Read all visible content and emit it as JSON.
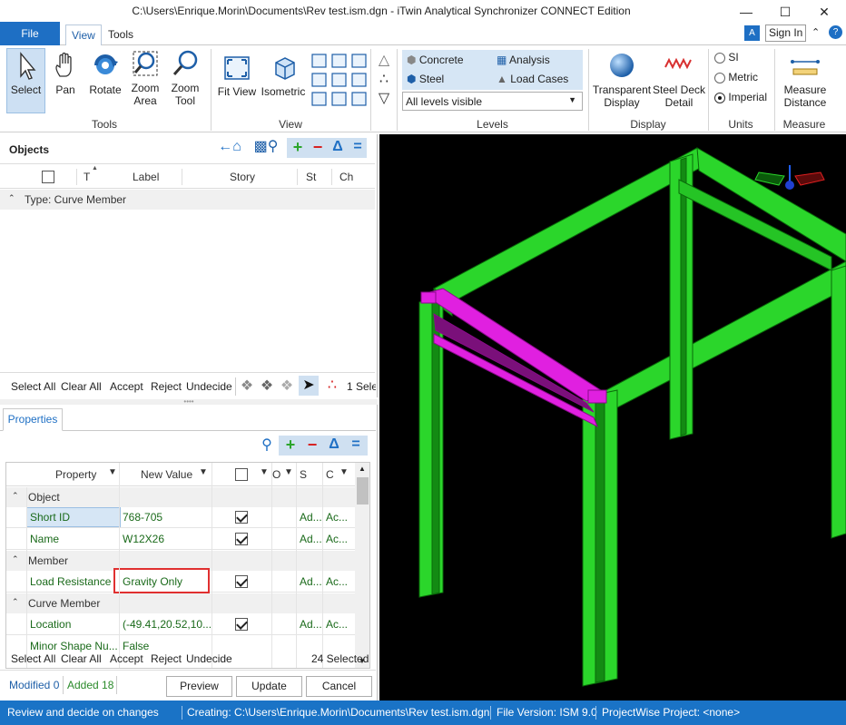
{
  "window": {
    "title": "C:\\Users\\Enrique.Morin\\Documents\\Rev test.ism.dgn - iTwin Analytical Synchronizer CONNECT Edition"
  },
  "menu": {
    "file": "File",
    "tabs": [
      "View",
      "Tools"
    ]
  },
  "account": {
    "sign_in": "Sign In"
  },
  "ribbon": {
    "tools": {
      "select": "Select",
      "pan": "Pan",
      "rotate": "Rotate",
      "zoom_area": [
        "Zoom",
        "Area"
      ],
      "zoom_tool": [
        "Zoom",
        "Tool"
      ],
      "group": "Tools"
    },
    "view": {
      "fit_view": "Fit View",
      "isometric": "Isometric",
      "group": "View"
    },
    "levels": {
      "concrete": "Concrete",
      "analysis": "Analysis",
      "steel": "Steel",
      "load_cases": "Load Cases",
      "dropdown": "All levels visible",
      "group": "Levels"
    },
    "display": {
      "transparent": [
        "Transparent",
        "Display"
      ],
      "steel_deck": [
        "Steel Deck",
        "Detail"
      ],
      "group": "Display"
    },
    "units": {
      "si": "SI",
      "metric": "Metric",
      "imperial": "Imperial",
      "selected": "Imperial",
      "group": "Units"
    },
    "measure": {
      "distance": [
        "Measure",
        "Distance"
      ],
      "group": "Measure"
    }
  },
  "objects": {
    "title": "Objects",
    "columns": [
      "T",
      "Label",
      "Story",
      "St",
      "Ch"
    ],
    "group_row": "Type: Curve Member",
    "actions": {
      "select_all": "Select All",
      "clear_all": "Clear All",
      "accept": "Accept",
      "reject": "Reject",
      "undecide": "Undecide",
      "selected": "1 Sele"
    }
  },
  "properties": {
    "tab": "Properties",
    "columns": {
      "property": "Property",
      "new_value": "New Value",
      "o": "O",
      "s": "S",
      "c": "C"
    },
    "groups": [
      {
        "name": "Object",
        "rows": [
          {
            "property": "Short ID",
            "value": "768-705",
            "checked": true,
            "s": "Ad...",
            "c": "Ac..."
          },
          {
            "property": "Name",
            "value": "W12X26",
            "checked": true,
            "s": "Ad...",
            "c": "Ac..."
          }
        ]
      },
      {
        "name": "Member",
        "rows": [
          {
            "property": "Load Resistance",
            "value": "Gravity Only",
            "checked": true,
            "s": "Ad...",
            "c": "Ac..."
          }
        ]
      },
      {
        "name": "Curve Member",
        "rows": [
          {
            "property": "Location",
            "value": "(-49.41,20.52,10...",
            "checked": true,
            "s": "Ad...",
            "c": "Ac..."
          },
          {
            "property": "Minor Shape Nu...",
            "value": "False",
            "checked": false,
            "s": "",
            "c": ""
          }
        ]
      }
    ],
    "actions": {
      "select_all": "Select All",
      "clear_all": "Clear All",
      "accept": "Accept",
      "reject": "Reject",
      "undecide": "Undecide",
      "selected": "24 Selected"
    }
  },
  "footer": {
    "modified": "Modified 0",
    "added": "Added 18",
    "preview": "Preview",
    "update": "Update",
    "cancel": "Cancel"
  },
  "status": {
    "message": "Review and decide on changes",
    "creating": "Creating: C:\\Users\\Enrique.Morin\\Documents\\Rev test.ism.dgn",
    "file_version": "File Version: ISM 9.0",
    "project": "ProjectWise Project: <none>"
  },
  "colors": {
    "accent": "#1e6fc4",
    "status_bar": "#1a73c6",
    "steel_green": "#2bd62b",
    "highlight_magenta": "#e020e0",
    "value_green": "#1a6a1a",
    "highlight_box": "#e03030"
  }
}
